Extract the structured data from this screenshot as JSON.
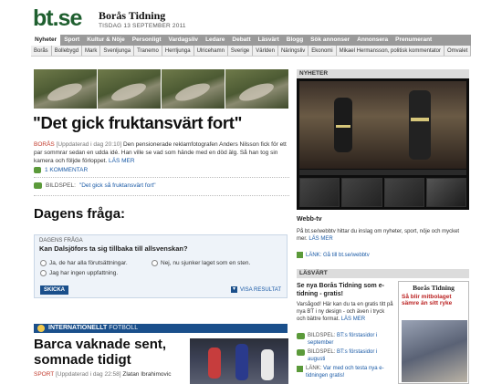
{
  "header": {
    "logo": "bt.se",
    "paper_name": "Borås Tidning",
    "date": "TISDAG 13 SEPTEMBER 2011"
  },
  "nav_primary": [
    "Nyheter",
    "Sport",
    "Kultur & Nöje",
    "Personligt",
    "Vardagsliv",
    "Ledare",
    "Debatt",
    "Läsvärt",
    "Blogg",
    "Sök annonser",
    "Annonsera",
    "Prenumerant"
  ],
  "nav_secondary": [
    "Borås",
    "Bollebygd",
    "Mark",
    "Svenljunga",
    "Tranemo",
    "Herrljunga",
    "Ulricehamn",
    "Sverige",
    "Världen",
    "Näringsliv",
    "Ekonomi",
    "Mikael Hermansson, politisk kommentator",
    "Omvalet"
  ],
  "main_story": {
    "headline": "\"Det gick fruktansvärt fort\"",
    "kicker": "BORÅS",
    "updated": "[Uppdaterad i dag 20:10]",
    "body": "Den pensionerade reklamfotografen Anders Nilsson fick för ett par sommrar sedan en udda idé. Han ville se vad som hände med en död älg. Så han tog sin kamera och följde förloppet.",
    "read_more": "LÄS MER",
    "comments": "1 KOMMENTAR",
    "gallery_label": "BILDSPEL:",
    "gallery_link": "\"Det gick så fruktansvärt fort\""
  },
  "poll": {
    "title": "Dagens fråga:",
    "box_header": "DAGENS FRÅGA",
    "question": "Kan Dalsjöfors ta sig tillbaka till allsvenskan?",
    "options": [
      "Ja, de har alla förutsättningar.",
      "Nej, nu sjunker laget som en sten.",
      "Jag har ingen uppfattning."
    ],
    "send": "SKICKA",
    "results": "VISA RESULTAT"
  },
  "international": {
    "bar_label": "INTERNATIONELLT",
    "bar_sub": "FOTBOLL",
    "headline": "Barca vaknade sent, somnade tidigt",
    "kicker": "SPORT",
    "updated": "[Uppdaterad i dag 22:58]",
    "text": "Zlatan Ibrahimovic"
  },
  "right": {
    "news_bar": "NYHETER",
    "webbtv_title": "Webb-tv",
    "webbtv_text": "På bt.se/webbtv hittar du inslag om nyheter, sport, nöje och mycket mer.",
    "webbtv_read_more": "LÄS MER",
    "webbtv_link": "LÄNK: Gå till bt.se/webbtv",
    "lasvart_bar": "LÄSVÄRT",
    "lasvart_title": "Se nya Borås Tidning som e-tidning - gratis!",
    "lasvart_text": "Varsågod! Här kan du ta en gratis titt på nya BT i ny design - och även i tryck och bättre format.",
    "lasvart_read_more": "LÄS MER",
    "link1_label": "BILDSPEL:",
    "link1_text": "BT:s förstasidor i september",
    "link2_label": "BILDSPEL:",
    "link2_text": "BT:s förstasidor i augusti",
    "link3_label": "LÄNK:",
    "link3_text": "Var med och testa nya e-tidningen gratis!",
    "mini_paper_name": "Borås Tidning",
    "mini_paper_head": "Så blir mitbolaget sämre än sitt ryke"
  },
  "colors": {
    "logo_green": "#1f5f2f",
    "nav_gray": "#9a9a9a",
    "link_blue": "#1a5aa6",
    "kicker_red": "#c0392b",
    "bar_blue": "#1a4f8b"
  }
}
